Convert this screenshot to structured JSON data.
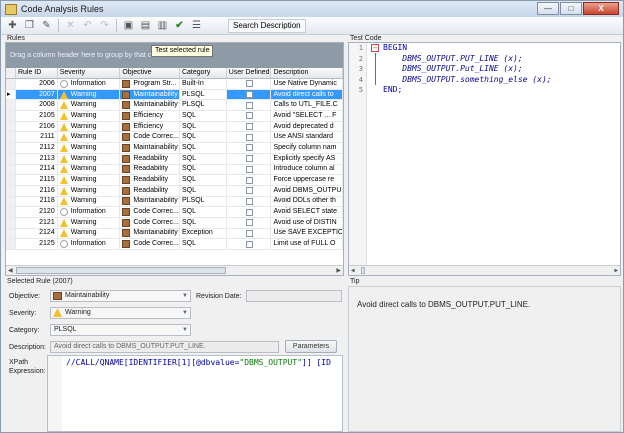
{
  "window": {
    "title": "Code Analysis Rules",
    "min": "—",
    "max": "□",
    "close": "X"
  },
  "toolbar": {
    "search_label": "Search Description",
    "tooltip": "Test selected rule"
  },
  "rules": {
    "panel_label": "Rules",
    "group_hint": "Drag a column header here to group by that column",
    "headers": {
      "id": "Rule ID",
      "severity": "Severity",
      "objective": "Objective",
      "category": "Category",
      "user_defined": "User Defined",
      "description": "Description"
    },
    "rows": [
      {
        "id": "2006",
        "severity": "Information",
        "objective": "Program Str...",
        "category": "Built-In",
        "description": "Use Native Dynamic"
      },
      {
        "id": "2007",
        "severity": "Warning",
        "objective": "Maintainability",
        "category": "PLSQL",
        "description": "Avoid direct calls to"
      },
      {
        "id": "2008",
        "severity": "Warning",
        "objective": "Maintainability",
        "category": "PLSQL",
        "description": "Calls to UTL_FILE.C"
      },
      {
        "id": "2105",
        "severity": "Warning",
        "objective": "Efficiency",
        "category": "SQL",
        "description": "Avoid \"SELECT ... F"
      },
      {
        "id": "2106",
        "severity": "Warning",
        "objective": "Efficiency",
        "category": "SQL",
        "description": "Avoid deprecated d"
      },
      {
        "id": "2111",
        "severity": "Warning",
        "objective": "Code Correc...",
        "category": "SQL",
        "description": "Use ANSI standard"
      },
      {
        "id": "2112",
        "severity": "Warning",
        "objective": "Maintainability",
        "category": "SQL",
        "description": "Specify column nam"
      },
      {
        "id": "2113",
        "severity": "Warning",
        "objective": "Readability",
        "category": "SQL",
        "description": "Explicitly specify AS"
      },
      {
        "id": "2114",
        "severity": "Warning",
        "objective": "Readability",
        "category": "SQL",
        "description": "Introduce column al"
      },
      {
        "id": "2115",
        "severity": "Warning",
        "objective": "Readability",
        "category": "SQL",
        "description": "Force uppercase re"
      },
      {
        "id": "2116",
        "severity": "Warning",
        "objective": "Readability",
        "category": "SQL",
        "description": "Avoid DBMS_OUTPU"
      },
      {
        "id": "2118",
        "severity": "Warning",
        "objective": "Maintainability",
        "category": "PLSQL",
        "description": "Avoid DDLs other th"
      },
      {
        "id": "2120",
        "severity": "Information",
        "objective": "Code Correc...",
        "category": "SQL",
        "description": "Avoid SELECT state"
      },
      {
        "id": "2121",
        "severity": "Warning",
        "objective": "Code Correc...",
        "category": "SQL",
        "description": "Avoid use of DISTIN"
      },
      {
        "id": "2124",
        "severity": "Warning",
        "objective": "Maintainability",
        "category": "Exception",
        "description": "Use SAVE EXCEPTIO"
      },
      {
        "id": "2125",
        "severity": "Information",
        "objective": "Code Correc...",
        "category": "SQL",
        "description": "Limit use of FULL O"
      }
    ]
  },
  "test_code": {
    "panel_label": "Test Code",
    "lines": [
      {
        "n": "1",
        "text": "BEGIN"
      },
      {
        "n": "2",
        "text": "    DBMS_OUTPUT.PUT_LINE (x);"
      },
      {
        "n": "3",
        "text": "    DBMS_OUTPUT.Put_LINE (x);"
      },
      {
        "n": "4",
        "text": "    DBMS_OUTPUT.something_else (x);"
      },
      {
        "n": "5",
        "text": "END;"
      }
    ]
  },
  "selected_rule": {
    "panel_label": "Selected Rule (2007)",
    "objective_label": "Objective:",
    "objective_value": "Maintainability",
    "revision_label": "Revision Date:",
    "revision_value": "",
    "severity_label": "Severity:",
    "severity_value": "Warning",
    "category_label": "Category:",
    "category_value": "PLSQL",
    "description_label": "Description:",
    "description_value": "Avoid direct calls to DBMS_OUTPUT.PUT_LINE.",
    "parameters_label": "Parameters",
    "xpath_label": "XPath Expression:",
    "xpath_prefix": "//CALL/QNAME[IDENTIFIER[1][@dbvalue=",
    "xpath_string": "\"DBMS_OUTPUT\"",
    "xpath_suffix": "]] [ID"
  },
  "tip": {
    "panel_label": "Tip",
    "text": "Avoid direct calls to DBMS_OUTPUT.PUT_LINE."
  }
}
